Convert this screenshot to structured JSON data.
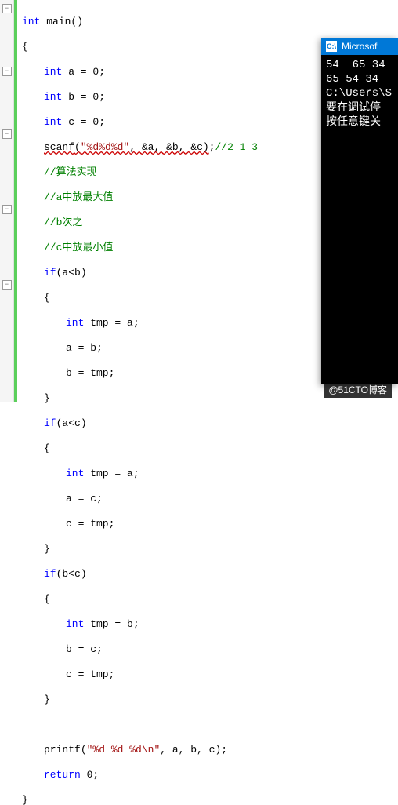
{
  "code": {
    "int": "int",
    "return": "return",
    "main_sig": " main()",
    "brace_open": "{",
    "brace_close": "}",
    "decl_a": " a = 0;",
    "decl_b": " b = 0;",
    "decl_c": " c = 0;",
    "scanf_fn": "scanf",
    "scanf_open": "(",
    "scanf_fmt": "\"%d%d%d\"",
    "scanf_args": ", &a, &b, &c)",
    "scanf_semi": ";",
    "scanf_cmt": "//2 1 3",
    "cmt1": "//算法实现",
    "cmt2": "//a中放最大值",
    "cmt3": "//b次之",
    "cmt4": "//c中放最小值",
    "if": "if",
    "cond_ab": "(a<b)",
    "cond_ac": "(a<c)",
    "cond_bc": "(b<c)",
    "tmp_a": " tmp = a;",
    "tmp_b": " tmp = b;",
    "a_eq_b": "a = b;",
    "a_eq_c": "a = c;",
    "b_eq_c": "b = c;",
    "b_eq_tmp": "b = tmp;",
    "c_eq_tmp": "c = tmp;",
    "printf_fn": "printf",
    "printf_open": "(",
    "printf_fmt": "\"%d %d %d\\n\"",
    "printf_args": ", a, b, c);",
    "ret_val": " 0;"
  },
  "console": {
    "title": "Microsof",
    "icon_label": "C:\\",
    "line1": "54  65 34",
    "line2": "65 54 34",
    "blank": "",
    "line3": "C:\\Users\\S",
    "line4": "要在调试停",
    "line5": "按任意键关"
  },
  "watermark": "@51CTO博客"
}
